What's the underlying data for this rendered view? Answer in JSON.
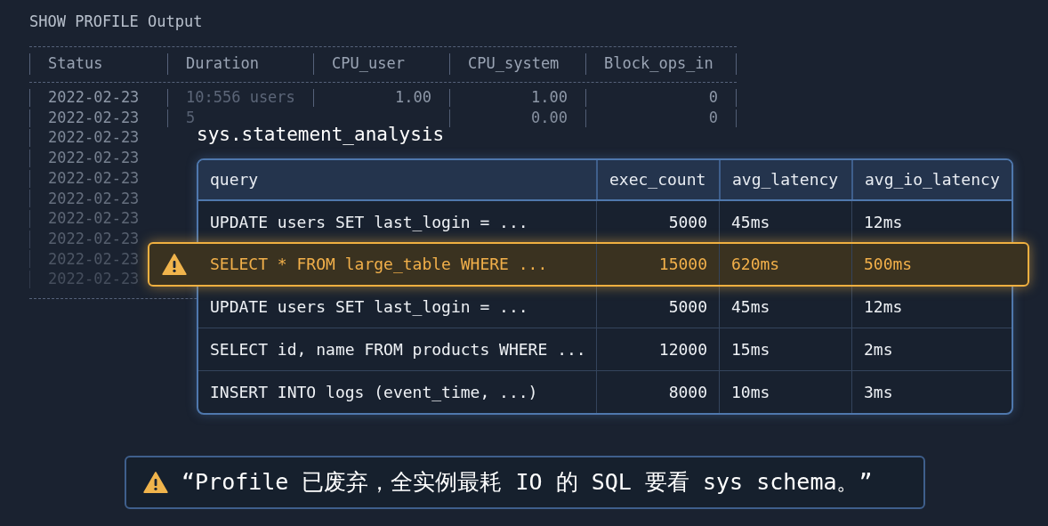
{
  "profile": {
    "title": "SHOW PROFILE Output",
    "columns": [
      "Status",
      "Duration",
      "CPU_user",
      "CPU_system",
      "Block_ops_in"
    ],
    "rows": [
      {
        "cells": [
          "2022-02-23",
          "10:556 users",
          "1.00",
          "1.00",
          "0"
        ]
      },
      {
        "cells": [
          "2022-02-23",
          "5",
          "",
          "0.00",
          "0"
        ]
      },
      {
        "cells": [
          "2022-02-23"
        ]
      },
      {
        "cells": [
          "2022-02-23"
        ]
      },
      {
        "cells": [
          "2022-02-23"
        ]
      },
      {
        "cells": [
          "2022-02-23"
        ]
      },
      {
        "cells": [
          "2022-02-23"
        ]
      },
      {
        "cells": [
          "2022-02-23"
        ]
      },
      {
        "cells": [
          "2022-02-23"
        ]
      },
      {
        "cells": [
          "2022-02-23"
        ]
      }
    ]
  },
  "analysis": {
    "title": "sys.statement_analysis",
    "columns": [
      "query",
      "exec_count",
      "avg_latency",
      "avg_io_latency"
    ],
    "rows": [
      {
        "cells": [
          "UPDATE users SET last_login = ...",
          "5000",
          "45ms",
          "12ms"
        ],
        "highlighted": false
      },
      {
        "cells": [
          "SELECT * FROM large_table WHERE ...",
          "15000",
          "620ms",
          "500ms"
        ],
        "highlighted": true
      },
      {
        "cells": [
          "UPDATE users SET last_login = ...",
          "5000",
          "45ms",
          "12ms"
        ],
        "highlighted": false
      },
      {
        "cells": [
          "SELECT id, name FROM products WHERE ...",
          "12000",
          "15ms",
          "2ms"
        ],
        "highlighted": false
      },
      {
        "cells": [
          "INSERT INTO logs (event_time, ...)",
          "8000",
          "10ms",
          "3ms"
        ],
        "highlighted": false
      }
    ]
  },
  "caption": "“Profile 已废弃，全实例最耗 IO 的 SQL 要看 sys schema。”"
}
